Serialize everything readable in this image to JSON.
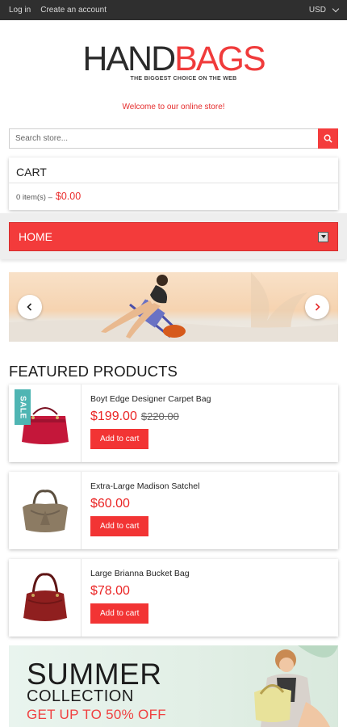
{
  "topbar": {
    "login": "Log in",
    "create_account": "Create an account",
    "currency": "USD"
  },
  "logo": {
    "part1": "HAND",
    "part2": "BAGS",
    "tagline": "THE BIGGEST CHOICE ON THE WEB"
  },
  "welcome": "Welcome to our online store!",
  "search": {
    "placeholder": "Search store..."
  },
  "cart": {
    "title": "CART",
    "items": "0 item(s) –",
    "total": "$0.00"
  },
  "nav": {
    "label": "HOME"
  },
  "featured": {
    "title": "FEATURED PRODUCTS"
  },
  "products": [
    {
      "name": "Boyt Edge Designer Carpet Bag",
      "price": "$199.00",
      "old_price": "$220.00",
      "sale": "SALE",
      "button": "Add to cart"
    },
    {
      "name": "Extra-Large Madison Satchel",
      "price": "$60.00",
      "button": "Add to cart"
    },
    {
      "name": "Large Brianna Bucket Bag",
      "price": "$78.00",
      "button": "Add to cart"
    }
  ],
  "banner": {
    "line1": "SUMMER",
    "line2": "COLLECTION",
    "line3": "GET UP TO 50% OFF"
  },
  "colors": {
    "accent": "#f33b3b",
    "topbar": "#2f2f2f",
    "sale": "#4fb5b3"
  }
}
